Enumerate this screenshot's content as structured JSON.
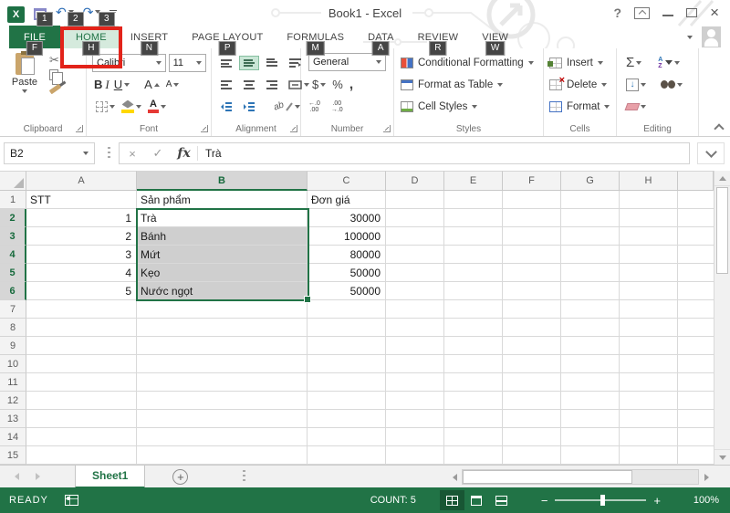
{
  "colors": {
    "accent_green": "#217346",
    "callout_red": "#e2231a",
    "selection_fill": "#cfcfcf",
    "keytip_bg": "#454545"
  },
  "titlebar": {
    "title": "Book1 - Excel",
    "help": "?",
    "qat_keytips": [
      "1",
      "2",
      "3"
    ]
  },
  "icons": {
    "scissors": "✂",
    "undo": "↶",
    "redo": "↷",
    "autosum": "Σ",
    "check": "✓",
    "cancel": "×",
    "close": "×",
    "fx": "fx",
    "sort_a": "A",
    "sort_z": "Z",
    "fill_down": "↓",
    "plus": "+"
  },
  "tabs": [
    {
      "label": "FILE",
      "keytip": "F"
    },
    {
      "label": "HOME",
      "keytip": "H"
    },
    {
      "label": "INSERT",
      "keytip": "N"
    },
    {
      "label": "PAGE LAYOUT",
      "keytip": "P"
    },
    {
      "label": "FORMULAS",
      "keytip": "M"
    },
    {
      "label": "DATA",
      "keytip": "A"
    },
    {
      "label": "REVIEW",
      "keytip": "R"
    },
    {
      "label": "VIEW",
      "keytip": "W"
    }
  ],
  "ribbon": {
    "clipboard": {
      "label": "Clipboard",
      "paste": "Paste"
    },
    "font": {
      "label": "Font",
      "name": "Calibri",
      "size": "11",
      "bold": "B",
      "italic": "I",
      "underline": "U",
      "grow": "A",
      "shrink": "A",
      "color_letter": "A"
    },
    "alignment": {
      "label": "Alignment",
      "orientation": "ab"
    },
    "number": {
      "label": "Number",
      "format": "General",
      "currency": "$",
      "percent": "%",
      "comma": ",",
      "inc_top": "←.0",
      "inc_bot": ".00",
      "dec_top": ".00",
      "dec_bot": "→.0"
    },
    "styles": {
      "label": "Styles",
      "items": [
        "Conditional Formatting",
        "Format as Table",
        "Cell Styles"
      ]
    },
    "cells": {
      "label": "Cells",
      "items": [
        "Insert",
        "Delete",
        "Format"
      ]
    },
    "editing": {
      "label": "Editing"
    }
  },
  "formula_bar": {
    "name_box": "B2",
    "value": "Trà"
  },
  "grid": {
    "columns": [
      "A",
      "B",
      "C",
      "D",
      "E",
      "F",
      "G",
      "H"
    ],
    "selection": {
      "range": "B2:B6",
      "active_cell": "B2"
    },
    "rows": [
      {
        "num": "1",
        "a": "STT",
        "b": "Sản phẩm",
        "c": "Đơn giá"
      },
      {
        "num": "2",
        "a": "1",
        "b": "Trà",
        "c": "30000"
      },
      {
        "num": "3",
        "a": "2",
        "b": "Bánh",
        "c": "100000"
      },
      {
        "num": "4",
        "a": "3",
        "b": "Mứt",
        "c": "80000"
      },
      {
        "num": "5",
        "a": "4",
        "b": "Kẹo",
        "c": "50000"
      },
      {
        "num": "6",
        "a": "5",
        "b": "Nước ngọt",
        "c": "50000"
      },
      {
        "num": "7",
        "a": "",
        "b": "",
        "c": ""
      },
      {
        "num": "8",
        "a": "",
        "b": "",
        "c": ""
      },
      {
        "num": "9",
        "a": "",
        "b": "",
        "c": ""
      },
      {
        "num": "10",
        "a": "",
        "b": "",
        "c": ""
      },
      {
        "num": "11",
        "a": "",
        "b": "",
        "c": ""
      },
      {
        "num": "12",
        "a": "",
        "b": "",
        "c": ""
      },
      {
        "num": "13",
        "a": "",
        "b": "",
        "c": ""
      },
      {
        "num": "14",
        "a": "",
        "b": "",
        "c": ""
      },
      {
        "num": "15",
        "a": "",
        "b": "",
        "c": ""
      }
    ]
  },
  "sheet_bar": {
    "sheet": "Sheet1"
  },
  "status_bar": {
    "mode": "READY",
    "count": "COUNT: 5",
    "zoom_out": "−",
    "zoom_in": "+",
    "zoom": "100%"
  }
}
